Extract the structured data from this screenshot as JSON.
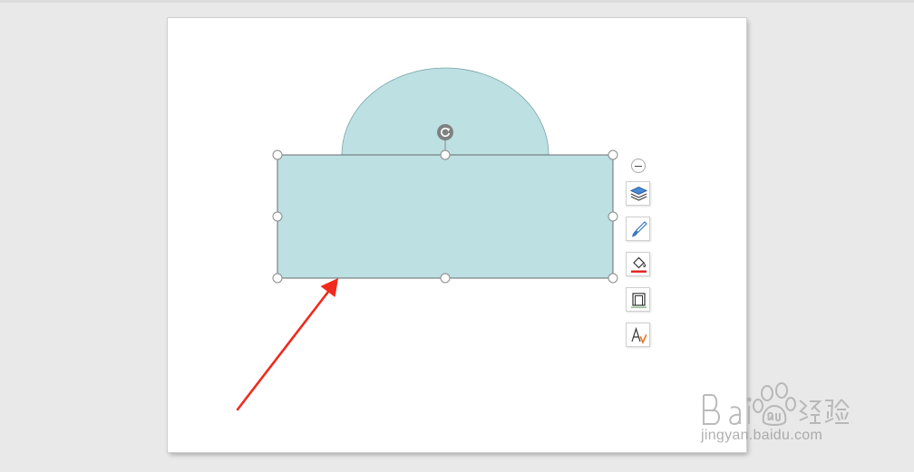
{
  "colors": {
    "shape_fill": "#bde0e3",
    "shape_stroke": "#7aa4a7",
    "handle_stroke": "#888888",
    "arrow": "#f02a1c",
    "icon_blue": "#3a78c2",
    "icon_red": "#e02020",
    "icon_orange": "#f07020"
  },
  "floating_toolbar": {
    "buttons": [
      {
        "name": "arrange-layers",
        "icon": "layers-icon"
      },
      {
        "name": "shape-style",
        "icon": "brush-icon"
      },
      {
        "name": "shape-fill",
        "icon": "paint-bucket-icon"
      },
      {
        "name": "shape-outline",
        "icon": "outline-icon"
      },
      {
        "name": "text-effects",
        "icon": "text-effect-icon"
      }
    ]
  },
  "watermark": {
    "logo": "Bai du 经验",
    "url": "jingyan.baidu.com"
  }
}
